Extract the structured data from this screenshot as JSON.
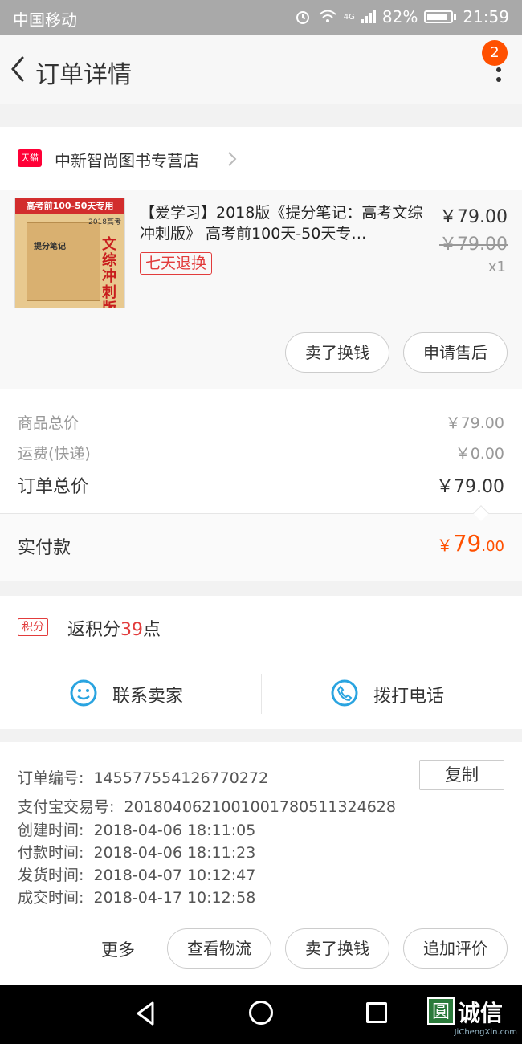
{
  "status_bar": {
    "carrier": "中国移动",
    "network": "4G",
    "battery": "82%",
    "time": "21:59"
  },
  "header": {
    "title": "订单详情",
    "notification_count": "2"
  },
  "shop": {
    "badge": "天猫",
    "name": "中新智尚图书专营店"
  },
  "product": {
    "thumbnail": {
      "top_banner": "高考前100-50天专用",
      "book_title": "提分笔记",
      "year": "2018高考",
      "vertical_title": "文综冲刺版"
    },
    "title": "【爱学习】2018版《提分笔记：高考文综冲刺版》 高考前100天-50天专…",
    "tag": "七天退换",
    "price": "￥79.00",
    "original_price": "￥79.00",
    "quantity": "x1",
    "buttons": {
      "resell": "卖了换钱",
      "after_sale": "申请售后"
    }
  },
  "summary": {
    "goods_total_label": "商品总价",
    "goods_total_value": "￥79.00",
    "shipping_label": "运费(快递)",
    "shipping_value": "￥0.00",
    "order_total_label": "订单总价",
    "order_total_value": "￥79.00",
    "paid_label": "实付款",
    "paid_currency": "￥",
    "paid_int": "79",
    "paid_dec": ".00"
  },
  "points": {
    "tag": "积分",
    "prefix": "返积分",
    "number": "39",
    "suffix": "点"
  },
  "contact": {
    "seller": "联系卖家",
    "phone": "拨打电话"
  },
  "order_info": {
    "order_no_label": "订单编号:",
    "order_no": "145577554126770272",
    "copy": "复制",
    "alipay_label": "支付宝交易号:",
    "alipay_no": "2018040621001001780511324628",
    "created_label": "创建时间:",
    "created": "2018-04-06 18:11:05",
    "paid_label": "付款时间:",
    "paid": "2018-04-06 18:11:23",
    "shipped_label": "发货时间:",
    "shipped": "2018-04-07 10:12:47",
    "done_label": "成交时间:",
    "done": "2018-04-17 10:12:58"
  },
  "actions": {
    "more": "更多",
    "logistics": "查看物流",
    "resell": "卖了换钱",
    "review": "追加评价"
  },
  "watermark": {
    "icon_char": "圓",
    "text": "诚信",
    "sub": "JiChengXin.com"
  },
  "colors": {
    "accent": "#ff5000",
    "tmall_red": "#ff0036",
    "tag_red": "#e23c3c",
    "chat_blue": "#2aa4e0"
  },
  "icons": [
    "back-arrow-icon",
    "more-dots-icon",
    "chevron-right-icon",
    "chat-face-icon",
    "phone-icon",
    "nav-back-icon",
    "nav-home-icon",
    "nav-recent-icon"
  ]
}
